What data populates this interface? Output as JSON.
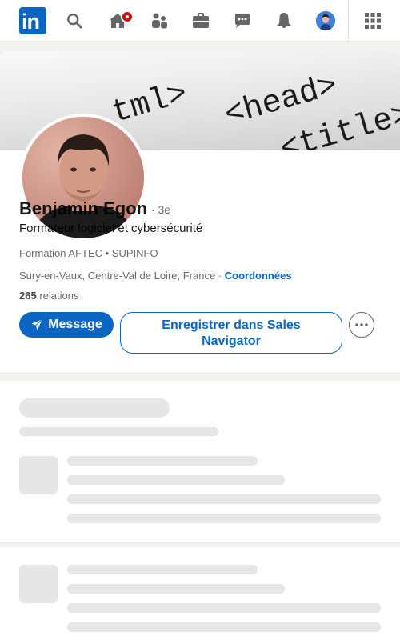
{
  "nav": {
    "logo_text": "in",
    "items": [
      {
        "name": "search-icon"
      },
      {
        "name": "home-icon",
        "badge": true
      },
      {
        "name": "network-icon"
      },
      {
        "name": "jobs-icon"
      },
      {
        "name": "messaging-icon"
      },
      {
        "name": "notifications-icon"
      },
      {
        "name": "me-avatar"
      },
      {
        "name": "apps-grid-icon"
      }
    ]
  },
  "profile": {
    "name": "Benjamin Egon",
    "degree": "· 3e",
    "headline": "Formateur logiciel et cybersécurité",
    "education": "Formation AFTEC • SUPINFO",
    "location": "Sury-en-Vaux, Centre-Val de Loire, France ·",
    "contact_link": "Coordonnées",
    "relations_count": "265",
    "relations_label": "relations",
    "cover_words": [
      "tml>",
      "<head>",
      "<title>"
    ]
  },
  "actions": {
    "message_label": "Message",
    "sales_nav_label": "Enregistrer dans Sales Navigator",
    "more_icon": "ellipsis-icon"
  },
  "colors": {
    "brand": "#0a66c2",
    "badge": "#cc1016",
    "skeleton": "#e6e6e6"
  }
}
